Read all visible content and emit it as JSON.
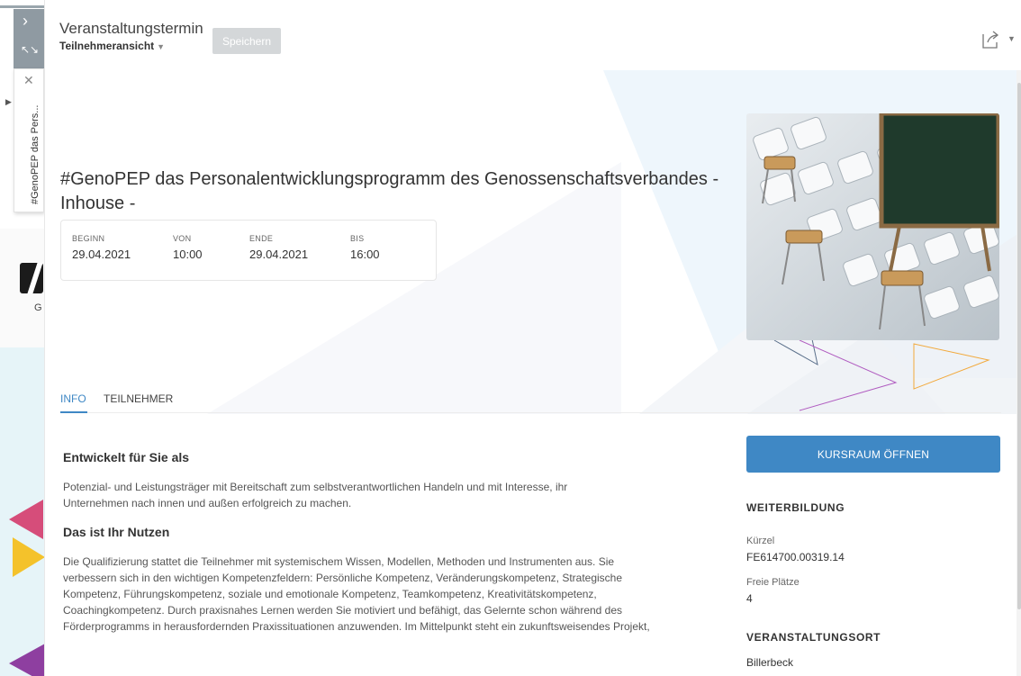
{
  "side_tab": {
    "label": "#GenoPEP das Pers..."
  },
  "header": {
    "title": "Veranstaltungstermin",
    "view_label": "Teilnehmeransicht",
    "save_label": "Speichern"
  },
  "event": {
    "title": "#GenoPEP das Personalentwicklungsprogramm des Genossenschaftsverbandes - Inhouse -",
    "dates": {
      "begin_label": "BEGINN",
      "begin_value": "29.04.2021",
      "from_label": "VON",
      "from_value": "10:00",
      "end_label": "ENDE",
      "end_value": "29.04.2021",
      "to_label": "BIS",
      "to_value": "16:00"
    }
  },
  "tabs": [
    {
      "label": "INFO",
      "active": true
    },
    {
      "label": "TEILNEHMER",
      "active": false
    }
  ],
  "content": {
    "heading1": "Entwickelt für Sie als",
    "para1": "Potenzial- und Leistungsträger mit Bereitschaft zum selbstverantwortlichen Handeln und mit Interesse, ihr Unternehmen nach innen und außen erfolgreich zu machen.",
    "heading2": "Das ist Ihr Nutzen",
    "para2": "Die Qualifizierung stattet die Teilnehmer mit systemischem Wissen, Modellen, Methoden und Instrumenten aus. Sie verbessern sich in den wichtigen Kompetenzfeldern: Persönliche Kompetenz, Veränderungskompetenz, Strategische Kompetenz, Führungskompetenz, soziale und emotionale Kompetenz, Teamkompetenz, Kreativitätskompetenz, Coachingkompetenz. Durch praxisnahes Lernen werden Sie motiviert und befähigt, das Gelernte schon während des Förderprogramms in herausfordernden Praxissituationen anzuwenden. Im Mittelpunkt steht ein zukunftsweisendes Projekt,"
  },
  "sidebar": {
    "open_button": "KURSRAUM ÖFFNEN",
    "section1_title": "WEITERBILDUNG",
    "kuerzel_label": "Kürzel",
    "kuerzel_value": "FE614700.00319.14",
    "plaetze_label": "Freie Plätze",
    "plaetze_value": "4",
    "section2_title": "VERANSTALTUNGSORT",
    "ort_value": "Billerbeck"
  },
  "colors": {
    "accent": "#3f88c5",
    "pink": "#d64d7a",
    "yellow": "#f4c22b",
    "purple": "#8e3fa0"
  }
}
